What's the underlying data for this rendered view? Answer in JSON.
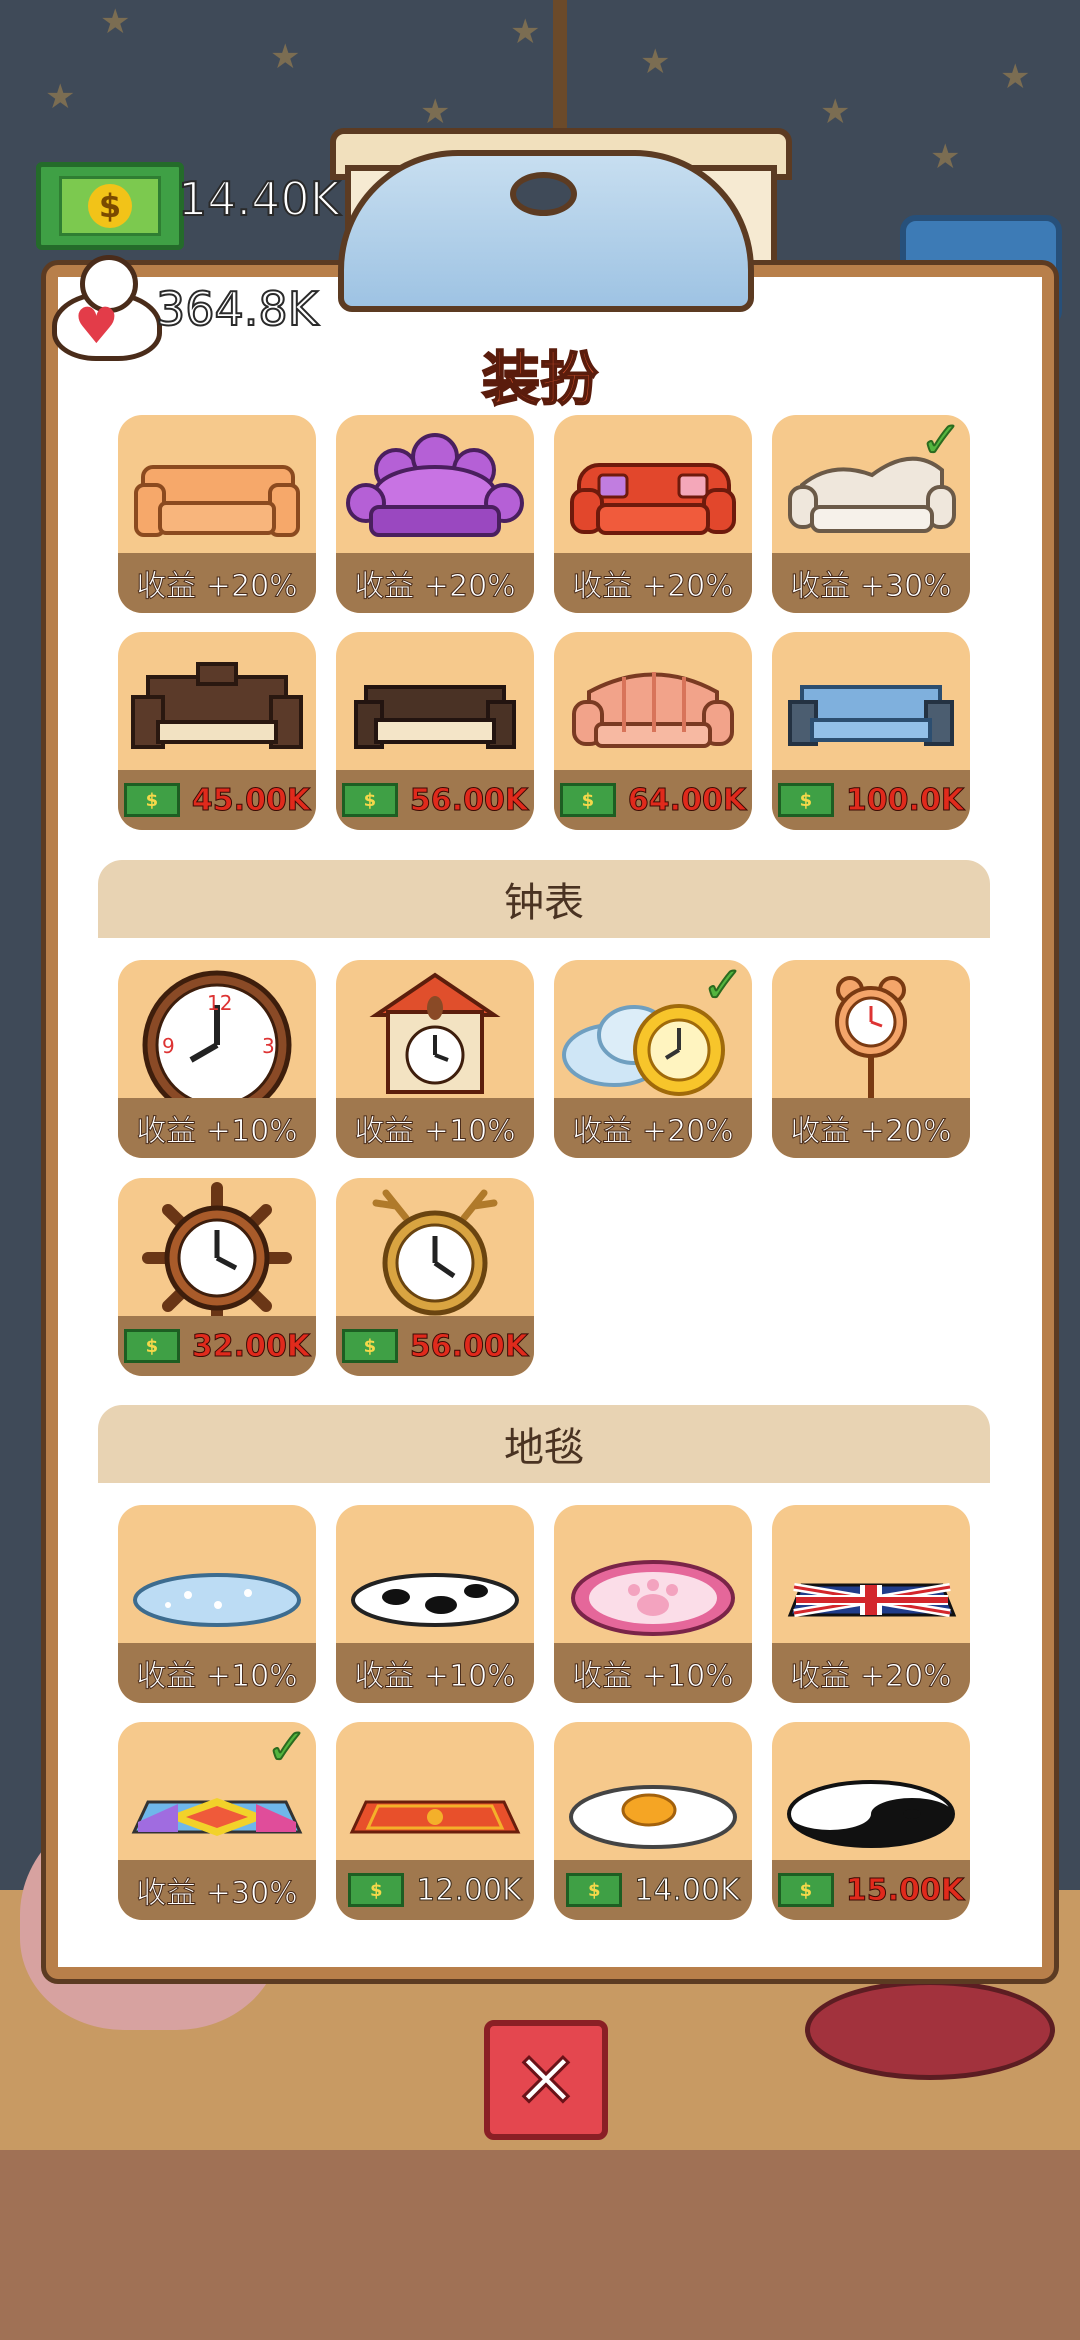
{
  "hud": {
    "money": "14.40K",
    "hearts": "364.8K"
  },
  "panel": {
    "title": "装扮"
  },
  "sections": [
    {
      "header": "钟表"
    },
    {
      "header": "地毯"
    }
  ],
  "items": {
    "sofas": [
      {
        "label": "收益 +20%",
        "owned": false,
        "kind": "sofa-orange"
      },
      {
        "label": "收益 +20%",
        "owned": false,
        "kind": "sofa-purple-paw"
      },
      {
        "label": "收益 +20%",
        "owned": false,
        "kind": "sofa-red"
      },
      {
        "label": "收益 +30%",
        "owned": true,
        "kind": "sofa-white"
      },
      {
        "price": "45.00K",
        "kind": "sofa-chinese"
      },
      {
        "price": "56.00K",
        "kind": "sofa-daybed"
      },
      {
        "price": "64.00K",
        "kind": "sofa-striped"
      },
      {
        "price": "100.0K",
        "kind": "sofa-blue"
      }
    ],
    "clocks": [
      {
        "label": "收益 +10%",
        "kind": "wall-clock"
      },
      {
        "label": "收益 +10%",
        "kind": "cuckoo-clock"
      },
      {
        "label": "收益 +20%",
        "owned": true,
        "kind": "sun-cloud-clock"
      },
      {
        "label": "收益 +20%",
        "kind": "bear-pendulum-clock"
      },
      {
        "price": "32.00K",
        "kind": "ship-wheel-clock"
      },
      {
        "price": "56.00K",
        "kind": "antler-clock"
      }
    ],
    "rugs": [
      {
        "label": "收益 +10%",
        "kind": "blue-oval-rug"
      },
      {
        "label": "收益 +10%",
        "kind": "cow-rug"
      },
      {
        "label": "收益 +10%",
        "kind": "paw-rug"
      },
      {
        "label": "收益 +20%",
        "kind": "union-jack-rug"
      },
      {
        "label": "收益 +30%",
        "owned": true,
        "kind": "rainbow-rug"
      },
      {
        "price": "12.00K",
        "kind": "red-carpet-rug"
      },
      {
        "price": "14.00K",
        "kind": "egg-rug"
      },
      {
        "price": "15.00K",
        "kind": "yin-yang-rug"
      }
    ]
  },
  "colors": {
    "card": "#f6c98c",
    "label_bar": "#a0784e",
    "price_red": "#e02a1c",
    "panel_border": "#b87f4a"
  }
}
